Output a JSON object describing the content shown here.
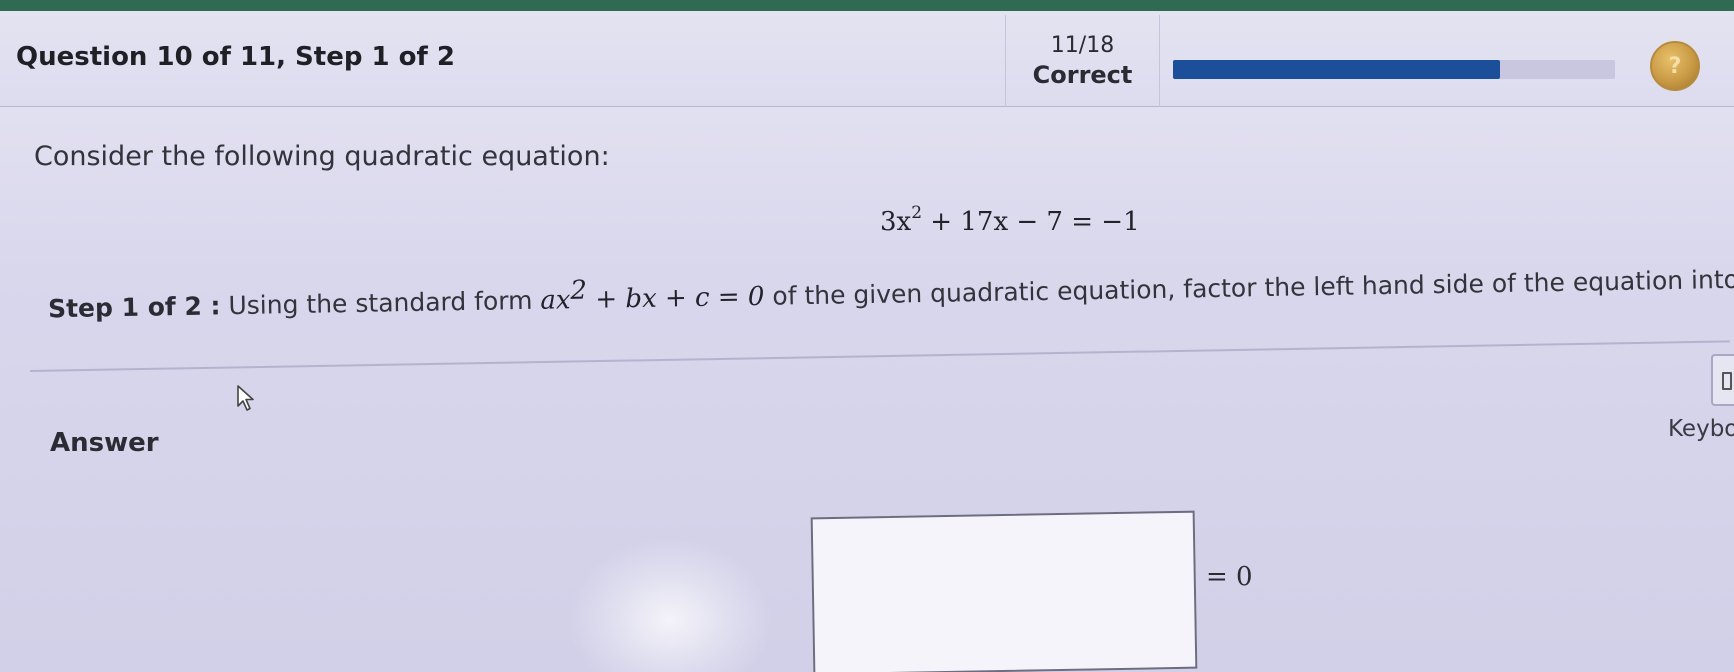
{
  "header": {
    "question_title": "Question 10 of 11, Step 1 of 2",
    "score_count": "11/18",
    "score_label": "Correct",
    "progress_fraction": 0.74,
    "progress_color": "#1b4f9a",
    "coin_icon": "achievement-coin-icon",
    "coin_glyph": "?"
  },
  "problem": {
    "intro": "Consider the following quadratic equation:",
    "equation_left_a": "3x",
    "equation_exp": "2",
    "equation_rest": " + 17x − 7 = −1"
  },
  "step": {
    "label": "Step 1 of 2 :",
    "text_before": " Using the standard form ",
    "form_a": "ax",
    "form_exp": "2",
    "form_rest": " + bx + c = 0",
    "text_after": " of the given quadratic equation, factor the left hand side of the equation into two linear factors."
  },
  "answer": {
    "label": "Answer",
    "input_value": "",
    "equals_zero": "= 0"
  },
  "keyboard": {
    "label": "Keyboa",
    "icon": "keyboard-icon"
  },
  "cursor": {
    "icon": "mouse-pointer-icon"
  }
}
